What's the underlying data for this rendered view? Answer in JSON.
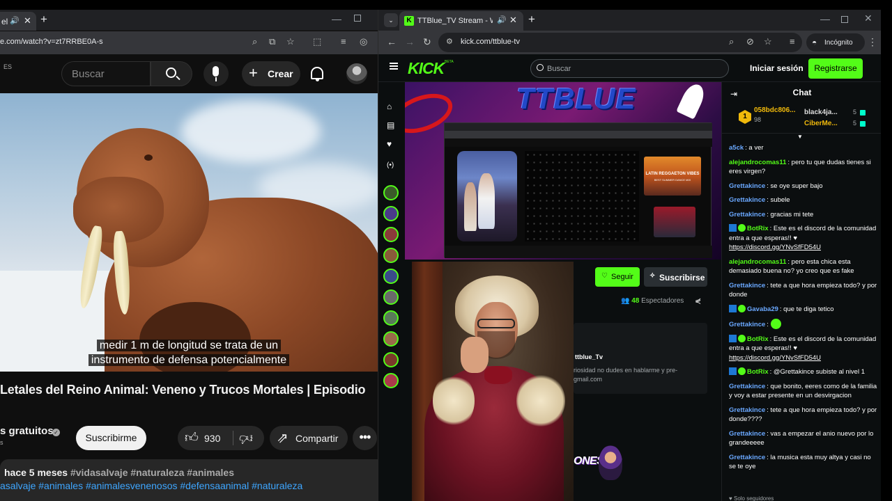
{
  "left_window": {
    "tab_title_partial": "el",
    "new_tab": "+",
    "url": "e.com/watch?v=zt7RRBE0A-s",
    "youtube": {
      "region": "ES",
      "search_placeholder": "Buscar",
      "create_label": "Crear"
    },
    "video": {
      "subtitle_line1": "medir 1 m de longitud se trata de un",
      "subtitle_line2": "instrumento de defensa potencialmente"
    },
    "title": "Letales del Reino Animal: Veneno y Trucos Mortales | Episodio",
    "channel": "s gratuitos",
    "channel_sub": "s",
    "subscribe_label": "Suscribirme",
    "likes": "930",
    "share_label": "Compartir",
    "more_label": "•••",
    "date": "hace 5 meses",
    "hashtags_line1": "#vidasalvaje #naturaleza #animales",
    "hashtags_line2": "asalvaje #animales #animalesvenenosos #defensaanimal #naturaleza"
  },
  "right_window": {
    "tab_title": "TTBlue_TV Stream - Watch",
    "new_tab": "+",
    "url": "kick.com/ttblue-tv",
    "incognito_label": "Incógnito",
    "kick": {
      "logo": "KICK",
      "beta": "BETA",
      "search_placeholder": "Buscar",
      "login_label": "Iniciar sesión",
      "register_label": "Registrarse"
    },
    "stream": {
      "overlay_title": "TTBLUE",
      "inner_card_title": "LATIN REGGAETON VIBES",
      "inner_card_sub": "BEST SUMMER DANCE MIX"
    },
    "follow_label": "Seguir",
    "subscribe_label": "Suscribirse",
    "viewers_count": "48",
    "viewers_label": "Espectadores",
    "about_name": "ttblue_Tv",
    "about_desc_line1": "riosidad no dudes en hablarme y pre-",
    "about_desc_line2": "gmail.com",
    "badge_text": "ONES",
    "chat": {
      "title": "Chat",
      "gifters": [
        {
          "name": "058bdc806...",
          "count": "98"
        },
        {
          "name": "black4ja...",
          "count": "5"
        },
        {
          "name": "CiberMe...",
          "count": "5"
        }
      ],
      "messages": [
        {
          "user": "a5ck",
          "text": ": a ver",
          "color": "#6aa8ff"
        },
        {
          "user": "alejandrocomas11",
          "text": ": pero tu que dudas tienes si eres virgen?",
          "color": "#53fc18"
        },
        {
          "user": "Grettakince",
          "text": ": se oye super bajo",
          "color": "#6aa8ff"
        },
        {
          "user": "Grettakince",
          "text": ": subele",
          "color": "#6aa8ff"
        },
        {
          "user": "Grettakince",
          "text": ": gracias mi tete",
          "color": "#6aa8ff"
        },
        {
          "user": "BotRix",
          "text": ": Este es el discord de la comunidad entra a que esperas!! ♥",
          "link": "https://discord.gg/YNvSfFD54U",
          "color": "#53fc18",
          "bot": true
        },
        {
          "user": "alejandrocomas11",
          "text": ": pero esta chica esta demasiado buena no? yo creo que es fake",
          "color": "#53fc18"
        },
        {
          "user": "Grettakince",
          "text": ": tete a que hora empieza todo? y por donde",
          "color": "#6aa8ff"
        },
        {
          "user": "Gavaba29",
          "text": ": que te diga tetico",
          "color": "#6aa8ff",
          "bot": true
        },
        {
          "user": "Grettakince",
          "text": ": ",
          "color": "#6aa8ff",
          "emote": true
        },
        {
          "user": "BotRix",
          "text": ": Este es el discord de la comunidad entra a que esperas!! ♥",
          "link": "https://discord.gg/YNvSfFD54U",
          "color": "#53fc18",
          "bot": true
        },
        {
          "user": "BotRix",
          "text": ": @Grettakince subiste al nivel 1",
          "color": "#53fc18",
          "bot": true
        },
        {
          "user": "Grettakince",
          "text": ": que bonito, eeres como de la familia y voy a estar presente en un desvirgacion",
          "color": "#6aa8ff"
        },
        {
          "user": "Grettakince",
          "text": ": tete a que hora empieza todo? y por donde????",
          "color": "#6aa8ff"
        },
        {
          "user": "Grettakince",
          "text": ": vas a empezar el anio nuevo por lo grandeeeee",
          "color": "#6aa8ff"
        },
        {
          "user": "Grettakince",
          "text": ": la musica esta muy altya y casi no se te oye",
          "color": "#6aa8ff"
        }
      ],
      "followers_only": "Solo seguidores"
    }
  }
}
